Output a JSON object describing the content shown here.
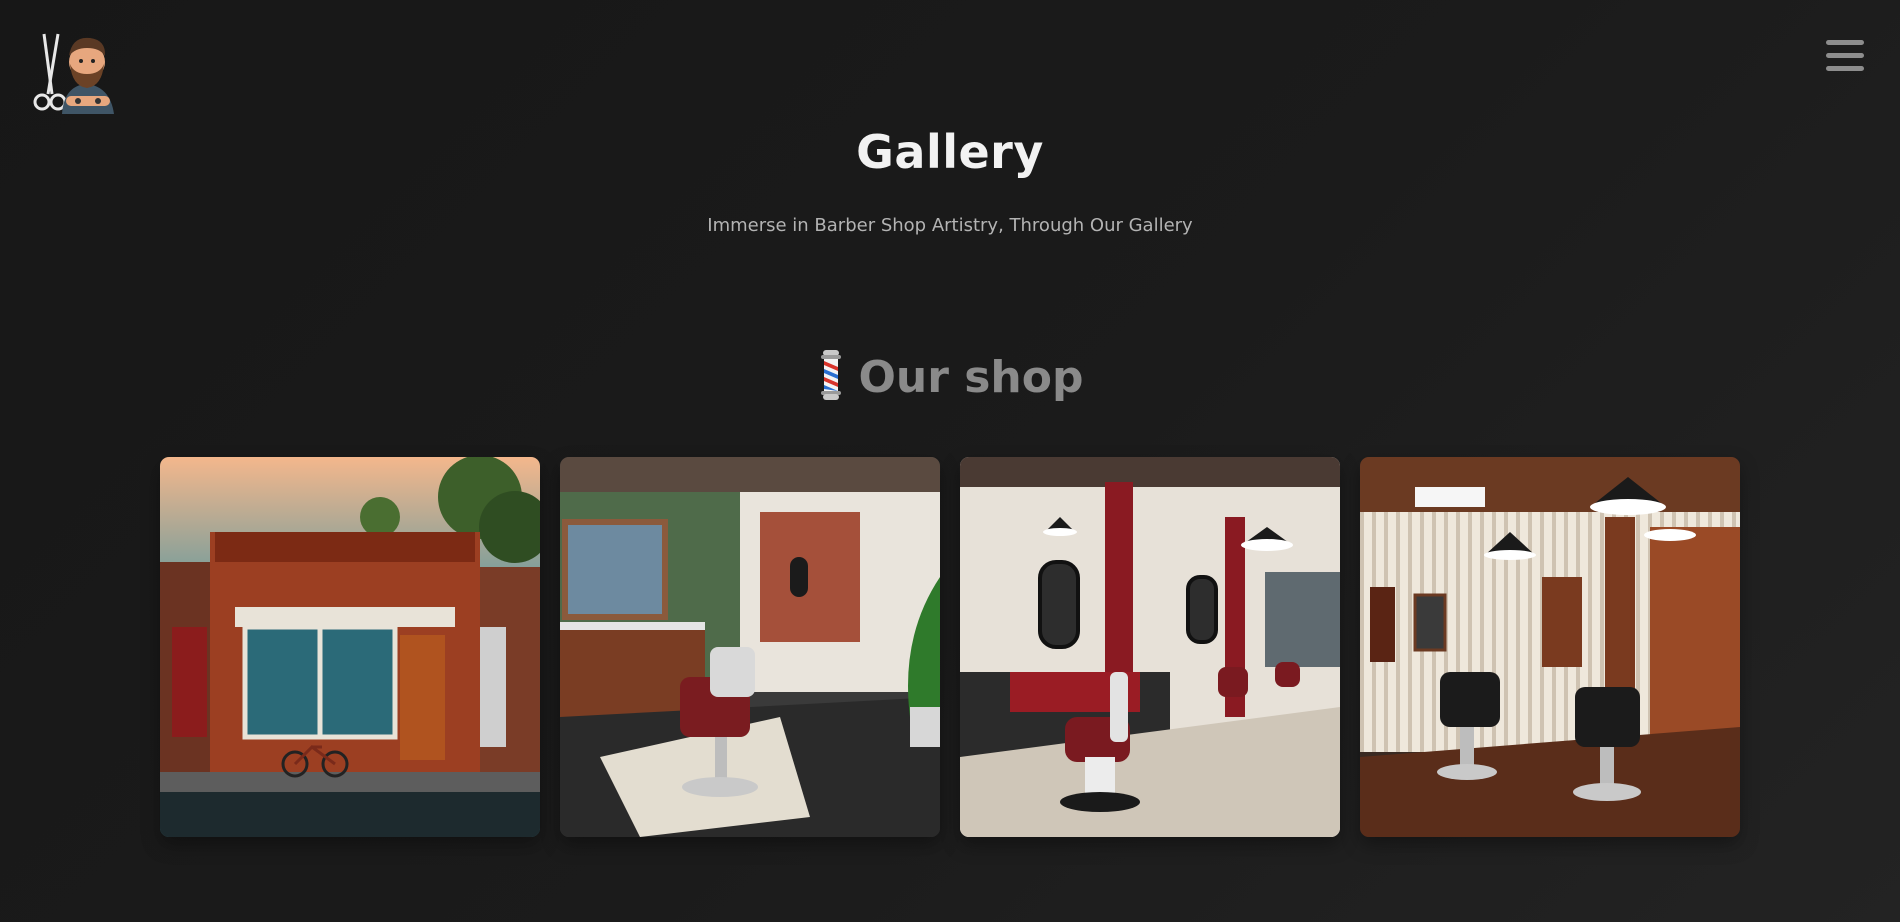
{
  "header": {
    "logo_icon": "barber-with-scissors-icon",
    "menu_icon": "hamburger-menu-icon"
  },
  "hero": {
    "title": "Gallery",
    "subtitle": "Immerse in Barber Shop Artistry, Through Our Gallery"
  },
  "section": {
    "icon": "barber-pole-icon",
    "title": "Our shop"
  },
  "colors": {
    "background": "#1a1a1a",
    "title": "#f2f2f2",
    "subtitle": "#b3b3b3",
    "section_title": "#8a8a8a",
    "menu_icon": "#8d8d8d"
  },
  "gallery": {
    "images": [
      {
        "name": "barbershop-storefront-image"
      },
      {
        "name": "green-wall-barber-interior-image"
      },
      {
        "name": "red-pillar-barber-interior-image"
      },
      {
        "name": "striped-wall-barber-interior-image"
      }
    ]
  }
}
